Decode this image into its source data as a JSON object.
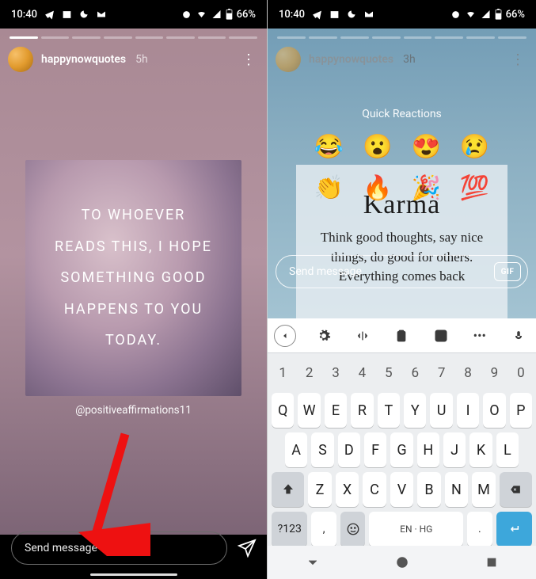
{
  "status": {
    "time": "10:40",
    "battery_text": "66%"
  },
  "left": {
    "username": "happynowquotes",
    "time_ago": "5h",
    "quote": {
      "l1": "To whoever",
      "l2": "reads this, I hope",
      "l3": "something good",
      "l4": "happens to you",
      "l5": "today."
    },
    "caption": "@positiveaffirmations11",
    "send_placeholder": "Send message"
  },
  "right": {
    "username": "happynowquotes",
    "time_ago": "3h",
    "quick_reactions_title": "Quick Reactions",
    "reactions_row1": [
      "😂",
      "😮",
      "😍",
      "😢"
    ],
    "reactions_row2": [
      "👏",
      "🔥",
      "🎉",
      "💯"
    ],
    "karma": {
      "title": "Karma",
      "body": "Think good thoughts, say nice things, do good for others. Everything comes back"
    },
    "send_placeholder": "Send message",
    "gif_label": "GIF",
    "keyboard": {
      "numbers": [
        "1",
        "2",
        "3",
        "4",
        "5",
        "6",
        "7",
        "8",
        "9",
        "0"
      ],
      "row1": [
        "Q",
        "W",
        "E",
        "R",
        "T",
        "Y",
        "U",
        "I",
        "O",
        "P"
      ],
      "row2": [
        "A",
        "S",
        "D",
        "F",
        "G",
        "H",
        "J",
        "K",
        "L"
      ],
      "row3": [
        "Z",
        "X",
        "C",
        "V",
        "B",
        "N",
        "M"
      ],
      "sym": "?123",
      "space": "EN · HG",
      "comma": ",",
      "dot": "."
    }
  }
}
